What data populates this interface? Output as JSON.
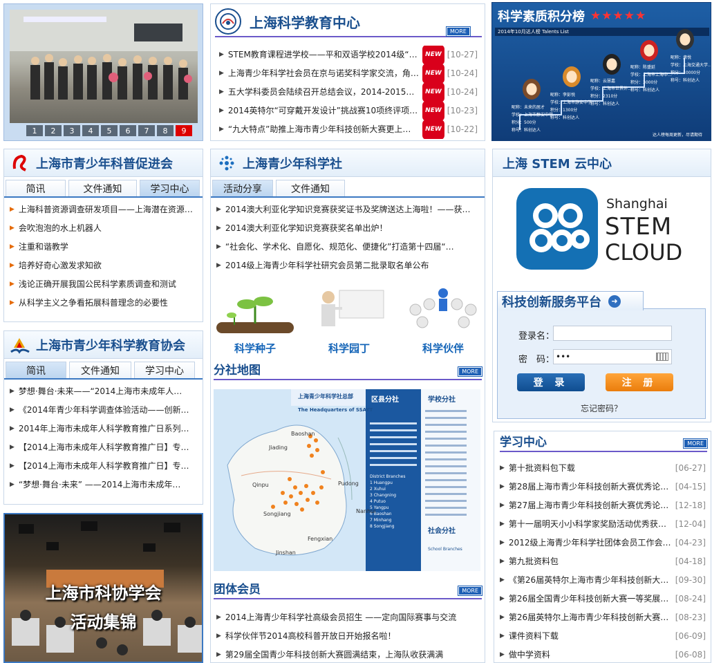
{
  "slideshow": {
    "pages": [
      "1",
      "2",
      "3",
      "4",
      "5",
      "6",
      "7",
      "8",
      "9"
    ],
    "active": "9"
  },
  "edu_center": {
    "title": "上海科学教育中心",
    "more": "MORE",
    "new_label": "NEW",
    "items": [
      {
        "text": "STEM教育课程进学校——平和双语学校2014级“科…",
        "date": "[10-27]"
      },
      {
        "text": "上海青少年科学社会员在京与诺奖科学家交流，角…",
        "date": "[10-24]"
      },
      {
        "text": "五大学科委员会陆续召开总结会议，2014-2015中学…",
        "date": "[10-24]"
      },
      {
        "text": "2014英特尔“可穿戴开发设计”挑战赛10项终评项…",
        "date": "[10-23]"
      },
      {
        "text": "“九大特点”助推上海市青少年科技创新大赛更上…",
        "date": "[10-22]"
      }
    ]
  },
  "ranking": {
    "title": "科学素质积分榜",
    "subtitle": "2014年10月达人榜  Talents List",
    "footer": "达人榜每周更新，尽请期待",
    "people": [
      {
        "nick": "昵称：未来的居才",
        "school": "学校：上海市静安中学",
        "score": "积分：500分",
        "title": "称号：科创达人"
      },
      {
        "nick": "昵称：李彭悦",
        "school": "学校：上海市静安中学",
        "score": "积分：1300分",
        "title": "称号：科创达人"
      },
      {
        "nick": "昵称：云慧嘉",
        "school": "学校：上海市世界外…",
        "score": "积分：2310分",
        "title": "称号：科创达人"
      },
      {
        "nick": "昵称：陈盛延",
        "school": "学校：上海市上海中…",
        "score": "积分：3000分",
        "title": "称号：科创达人"
      },
      {
        "nick": "昵称：肃悦",
        "school": "学校：上海交通大学…",
        "score": "积分：10000分",
        "title": "称号：科创达人"
      }
    ]
  },
  "promo": {
    "title": "上海市青少年科普促进会",
    "tabs": [
      "简讯",
      "文件通知",
      "学习中心"
    ],
    "active_tab": "学习中心",
    "items": [
      "上海科普资源调查研发项目——上海潜在资源…",
      "会吹泡泡的水上机器人",
      "注重和谐教学",
      "培养好奇心激发求知欲",
      "浅论正确开展我国公民科学素质调查和测试",
      "从科学主义之争看拓展科普理念的必要性"
    ]
  },
  "society": {
    "title": "上海青少年科学社",
    "tabs": [
      "活动分享",
      "文件通知"
    ],
    "active_tab": "活动分享",
    "items": [
      "2014澳大利亚化学知识竞赛获奖证书及奖牌送达上海啦！——获…",
      "2014澳大利亚化学知识竞赛获奖名单出炉！",
      "“社会化、学术化、自愿化、规范化、便捷化”打造第十四届“…",
      "2014级上海青少年科学社研究会员第二批录取名单公布"
    ],
    "features": [
      {
        "label": "科学种子"
      },
      {
        "label": "科学园丁"
      },
      {
        "label": "科学伙伴"
      }
    ]
  },
  "map": {
    "title": "分社地图",
    "more": "MORE",
    "header": "上海青少年科学社总部",
    "header_en": "The Headquarters of SSAYT",
    "district_title": "区县分社",
    "school_title": "学校分社",
    "society_title": "社会分社",
    "places": [
      "Baoshan",
      "Jiading",
      "Qinpu",
      "Songjiang",
      "Jinshan",
      "Fengxian",
      "Pudong",
      "Nanhui"
    ],
    "district_en": "District Branches",
    "districts_en": [
      "1 Huangpu",
      "2 Xuhui",
      "3 Changning",
      "4 Putuo",
      "5 Yangpu",
      "6 Baoshan",
      "7 Minhang",
      "8 Songjiang"
    ],
    "school_en": "School Branches"
  },
  "members": {
    "title": "团体会员",
    "more": "MORE",
    "items": [
      "2014上海青少年科学社高级会员招生 ——定向国际赛事与交流",
      "科学伙伴节2014高校科普开放日开始报名啦！",
      "第29届全国青少年科技创新大赛圆满结束，上海队收获满满"
    ]
  },
  "edu_assoc": {
    "title": "上海市青少年科学教育协会",
    "tabs": [
      "简讯",
      "文件通知",
      "学习中心"
    ],
    "active_tab": "简讯",
    "items": [
      "梦想·舞台·未来——“2014上海市未成年人…",
      "《2014年青少年科学调查体验活动——创新在…",
      "2014年上海市未成年人科学教育推广日系列活…",
      "【2014上海市未成年人科学教育推广日】专辑…",
      "【2014上海市未成年人科学教育推广日】专辑…",
      "“梦想·舞台·未来” ——2014上海市未成年…"
    ]
  },
  "gallery": {
    "line1": "上海市科协学会",
    "line2": "活动集锦"
  },
  "stem_cloud": {
    "title": "上海 STEM 云中心",
    "brand1": "Shanghai",
    "brand2": "STEM",
    "brand3": "CLOUD"
  },
  "login": {
    "title": "科技创新服务平台",
    "username_label": "登录名：",
    "password_label": "密　码：",
    "password_value": "•••",
    "login_btn": "登 录",
    "register_btn": "注 册",
    "forgot": "忘记密码？"
  },
  "study": {
    "title": "学习中心",
    "more": "MORE",
    "items": [
      {
        "text": "第十批资料包下载",
        "date": "[06-27]"
      },
      {
        "text": "第28届上海市青少年科技创新大赛优秀论文…",
        "date": "[04-15]"
      },
      {
        "text": "第27届上海市青少年科技创新大赛优秀论文…",
        "date": "[12-18]"
      },
      {
        "text": "第十一届明天小小科学家奖励活动优秀获奖…",
        "date": "[12-04]"
      },
      {
        "text": "2012级上海青少年科学社团体会员工作会议…",
        "date": "[04-23]"
      },
      {
        "text": "第九批资料包",
        "date": "[04-18]"
      },
      {
        "text": "《第26届英特尔上海市青少年科技创新大赛…",
        "date": "[09-30]"
      },
      {
        "text": "第26届全国青少年科技创新大赛一等奖展板…",
        "date": "[08-24]"
      },
      {
        "text": "第26届英特尔上海市青少年科技创新大赛一…",
        "date": "[08-23]"
      },
      {
        "text": "课件资料下载",
        "date": "[06-09]"
      },
      {
        "text": "做中学资料",
        "date": "[06-08]"
      }
    ]
  }
}
